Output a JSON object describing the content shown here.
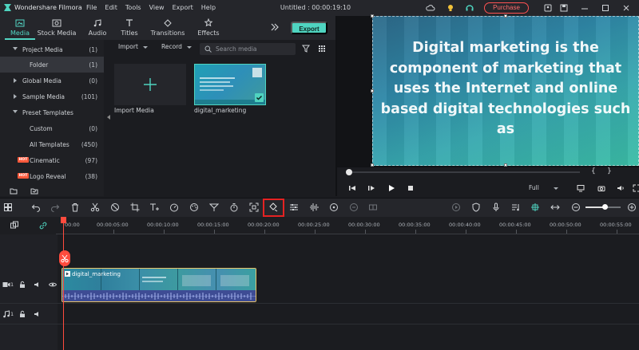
{
  "app": {
    "title": "Wondershare Filmora",
    "project_title": "Untitled : 00:00:19:10",
    "menu": [
      "File",
      "Edit",
      "Tools",
      "View",
      "Export",
      "Help"
    ],
    "purchase_label": "Purchase"
  },
  "tabs": [
    {
      "label": "Media",
      "icon": "media-icon",
      "active": true
    },
    {
      "label": "Stock Media",
      "icon": "stock-media-icon"
    },
    {
      "label": "Audio",
      "icon": "audio-icon"
    },
    {
      "label": "Titles",
      "icon": "titles-icon"
    },
    {
      "label": "Transitions",
      "icon": "transitions-icon"
    },
    {
      "label": "Effects",
      "icon": "effects-icon"
    }
  ],
  "export_label": "Export",
  "sidebar": {
    "items": [
      {
        "label": "Project Media",
        "count": "(1)"
      },
      {
        "label": "Folder",
        "count": "(1)"
      },
      {
        "label": "Global Media",
        "count": "(0)"
      },
      {
        "label": "Sample Media",
        "count": "(101)"
      },
      {
        "label": "Preset Templates",
        "count": ""
      },
      {
        "label": "Custom",
        "count": "(0)"
      },
      {
        "label": "All Templates",
        "count": "(450)"
      },
      {
        "label": "Cinematic",
        "count": "(97)"
      },
      {
        "label": "Logo Reveal",
        "count": "(38)"
      }
    ],
    "hot_badge": "HOT"
  },
  "media": {
    "import_dropdown": "Import",
    "record_dropdown": "Record",
    "search_placeholder": "Search media",
    "import_tile_label": "Import Media",
    "clip_label": "digital_marketing"
  },
  "preview": {
    "text": "Digital marketing is the component of marketing that uses the Internet and online based digital technologies such as",
    "brace_open": "{",
    "brace_close": "}",
    "quality": "Full"
  },
  "timeline": {
    "ruler": [
      "00:00",
      "00:00:05:00",
      "00:00:10:00",
      "00:00:15:00",
      "00:00:20:00",
      "00:00:25:00",
      "00:00:30:00",
      "00:00:35:00",
      "00:00:40:00",
      "00:00:45:00",
      "00:00:50:00",
      "00:00:55:00"
    ],
    "clip_name": "digital_marketing",
    "video_track_label": "1",
    "audio_track_label": "1"
  },
  "colors": {
    "accent": "#4fd4c0",
    "purchase": "#ff5252",
    "playhead": "#ff4b3e",
    "highlight": "#e52222"
  }
}
